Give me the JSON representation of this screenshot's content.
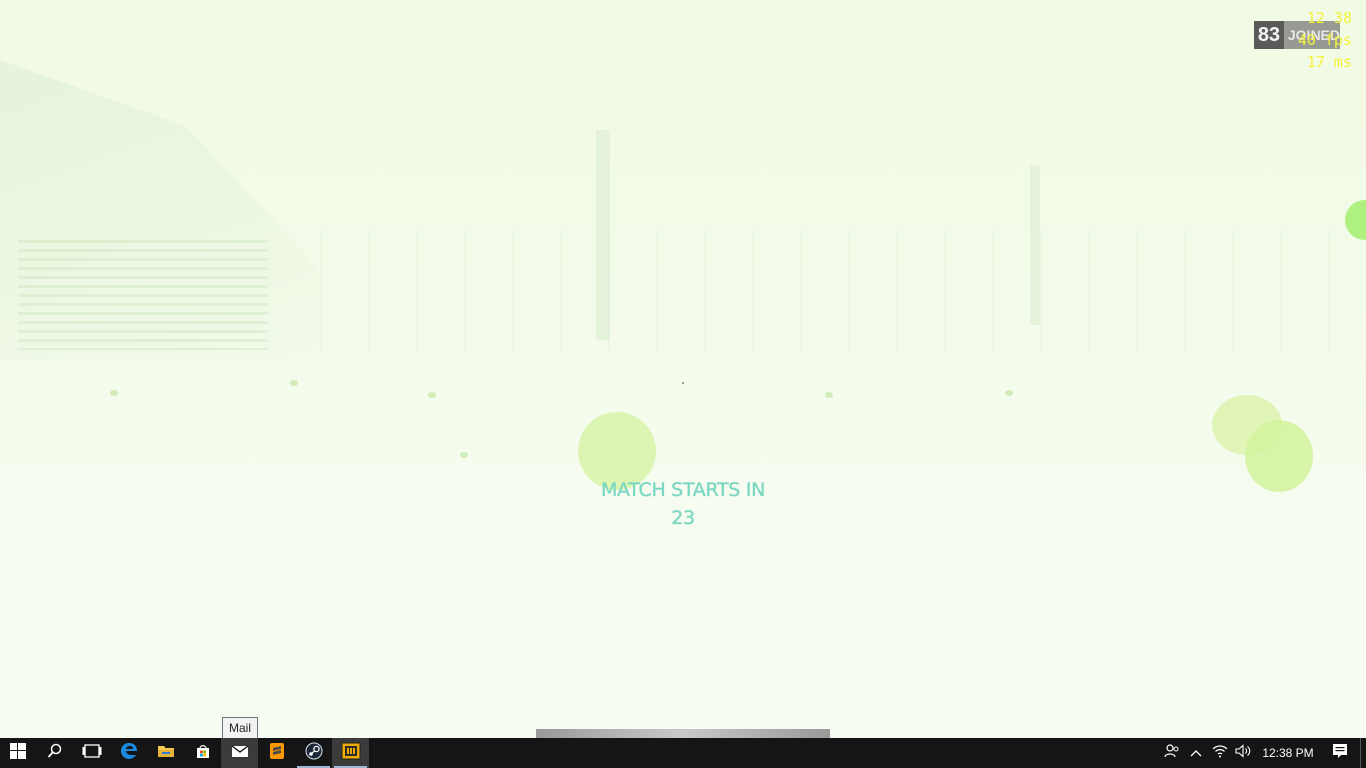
{
  "game": {
    "match_banner_line1": "MATCH STARTS IN",
    "match_banner_countdown": "23",
    "hud": {
      "players_count": "83",
      "players_label": "JOINED",
      "clock": "12 38",
      "fps": "40 fps",
      "latency": "17 ms"
    }
  },
  "tooltip": {
    "text": "Mail"
  },
  "progress": {
    "fraction": 1.0
  },
  "taskbar": {
    "apps": [
      {
        "name": "start",
        "icon": "windows-icon"
      },
      {
        "name": "search",
        "icon": "search-icon"
      },
      {
        "name": "task-view",
        "icon": "task-view-icon"
      },
      {
        "name": "edge",
        "icon": "edge-icon"
      },
      {
        "name": "file-explorer",
        "icon": "folder-icon"
      },
      {
        "name": "store",
        "icon": "store-icon"
      },
      {
        "name": "mail",
        "icon": "mail-icon"
      },
      {
        "name": "sublime",
        "icon": "sublime-icon"
      },
      {
        "name": "steam",
        "icon": "steam-icon"
      },
      {
        "name": "pubg",
        "icon": "pubg-icon"
      }
    ],
    "clock": "12:38 PM"
  },
  "colors": {
    "banner": "#7cd9c4",
    "stats": "#f4f33a",
    "taskbar": "#151515"
  }
}
